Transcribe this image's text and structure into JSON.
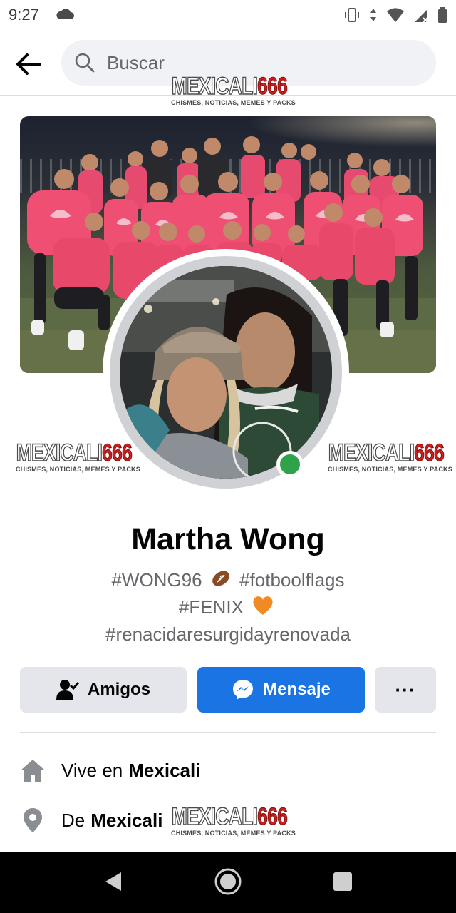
{
  "status_bar": {
    "time": "9:27",
    "icons": [
      "cloud-icon",
      "vibrate-icon",
      "data-arrows-icon",
      "wifi-icon",
      "signal-icon",
      "battery-icon"
    ]
  },
  "header": {
    "search_placeholder": "Buscar"
  },
  "watermark": {
    "brand_text": "MEXICALI",
    "brand_number": "666",
    "tagline": "CHISMES, NOTICIAS, MEMES Y PACKS",
    "brand_color": "#c91f1f"
  },
  "profile": {
    "name": "Martha Wong",
    "bio_line1_a": "#WONG96",
    "bio_line1_b": "#fotboolflags",
    "bio_line2": "#FENIX",
    "bio_line3": "#renacidaresurgidayrenovada",
    "online": true
  },
  "actions": {
    "friends_label": "Amigos",
    "message_label": "Mensaje",
    "more_label": "···"
  },
  "details": {
    "lives_prefix": "Vive en",
    "lives_city": "Mexicali",
    "from_prefix": "De",
    "from_city": "Mexicali"
  },
  "colors": {
    "accent": "#1b74e4",
    "online": "#31a24c",
    "secondary_button": "#e4e6eb",
    "muted_text": "#65676b"
  }
}
